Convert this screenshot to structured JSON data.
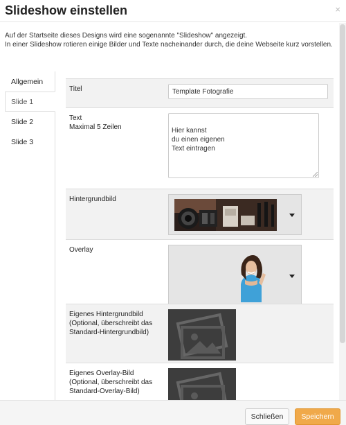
{
  "dialog": {
    "title": "Slideshow einstellen",
    "close_glyph": "×",
    "intro": "Auf der Startseite dieses Designs wird eine sogenannte \"Slideshow\" angezeigt.\nIn einer Slideshow rotieren einige Bilder und Texte nacheinander durch, die deine Webseite kurz vorstellen."
  },
  "tabs": [
    {
      "label": "Allgemein",
      "active": false
    },
    {
      "label": "Slide 1",
      "active": true
    },
    {
      "label": "Slide 2",
      "active": false
    },
    {
      "label": "Slide 3",
      "active": false
    }
  ],
  "form": {
    "title": {
      "label": "Titel",
      "value": "Template Fotografie"
    },
    "text": {
      "label": "Text",
      "sublabel": "Maximal 5 Zeilen",
      "value": "Hier kannst\ndu einen eigenen\nText eintragen"
    },
    "background": {
      "label": "Hintergrundbild",
      "image": "camera-lenses-photo"
    },
    "overlay": {
      "label": "Overlay",
      "image": "smiling-woman-photo"
    },
    "custom_background": {
      "label": "Eigenes Hintergrundbild\n(Optional, überschreibt das Standard-Hintergrundbild)",
      "image": "image-placeholder-icon"
    },
    "custom_overlay": {
      "label": "Eigenes Overlay-Bild\n(Optional, überschreibt das Standard-Overlay-Bild)",
      "image": "image-placeholder-icon"
    }
  },
  "footer": {
    "close_label": "Schließen",
    "save_label": "Speichern"
  },
  "colors": {
    "accent": "#f0a94a",
    "border": "#dddddd",
    "shaded_row": "#f2f2f2"
  }
}
